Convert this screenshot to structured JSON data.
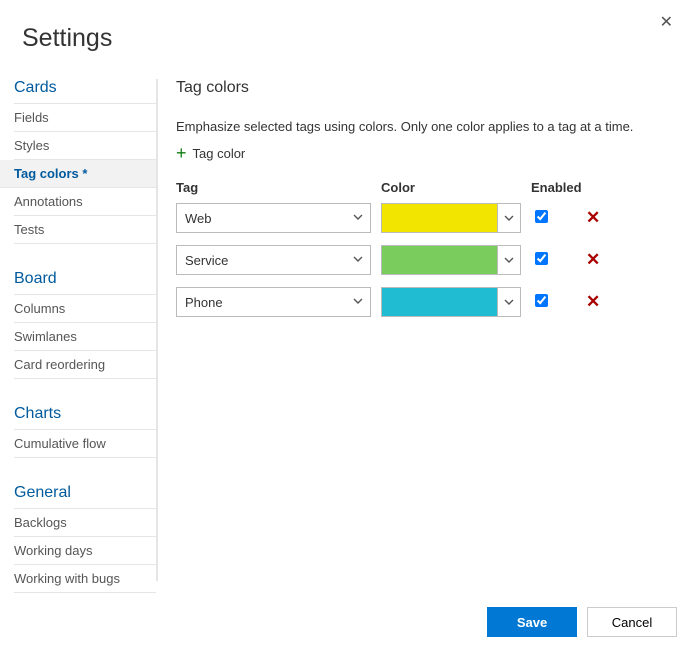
{
  "dialog": {
    "title": "Settings"
  },
  "sidebar": {
    "groups": [
      {
        "header": "Cards",
        "items": [
          {
            "label": "Fields",
            "active": false
          },
          {
            "label": "Styles",
            "active": false
          },
          {
            "label": "Tag colors *",
            "active": true
          },
          {
            "label": "Annotations",
            "active": false
          },
          {
            "label": "Tests",
            "active": false
          }
        ]
      },
      {
        "header": "Board",
        "items": [
          {
            "label": "Columns",
            "active": false
          },
          {
            "label": "Swimlanes",
            "active": false
          },
          {
            "label": "Card reordering",
            "active": false
          }
        ]
      },
      {
        "header": "Charts",
        "items": [
          {
            "label": "Cumulative flow",
            "active": false
          }
        ]
      },
      {
        "header": "General",
        "items": [
          {
            "label": "Backlogs",
            "active": false
          },
          {
            "label": "Working days",
            "active": false
          },
          {
            "label": "Working with bugs",
            "active": false
          }
        ]
      }
    ]
  },
  "content": {
    "title": "Tag colors",
    "description": "Emphasize selected tags using colors. Only one color applies to a tag at a time.",
    "add_label": "Tag color",
    "columns": {
      "tag": "Tag",
      "color": "Color",
      "enabled": "Enabled"
    },
    "rows": [
      {
        "tag": "Web",
        "color": "#F2E600",
        "enabled": true
      },
      {
        "tag": "Service",
        "color": "#7ACC5C",
        "enabled": true
      },
      {
        "tag": "Phone",
        "color": "#1FBCD2",
        "enabled": true
      }
    ]
  },
  "footer": {
    "save": "Save",
    "cancel": "Cancel"
  }
}
